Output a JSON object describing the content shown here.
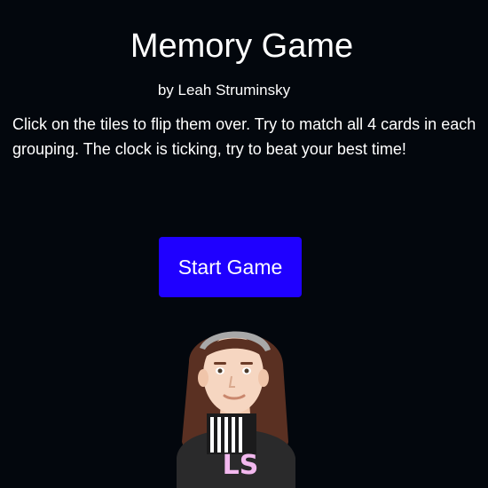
{
  "header": {
    "title": "Memory Game",
    "byline": "by Leah Struminsky"
  },
  "instructions": "Click on the tiles to flip them over. Try to match all 4 cards in each grouping. The clock is ticking, try to beat your best time!",
  "start_button": {
    "label": "Start Game"
  },
  "avatar": {
    "initials": "LS",
    "icon": "avatar-illustration"
  },
  "colors": {
    "background": "#03070d",
    "button": "#1f00ff",
    "text": "#ffffff",
    "initials": "#f2b8ee"
  }
}
